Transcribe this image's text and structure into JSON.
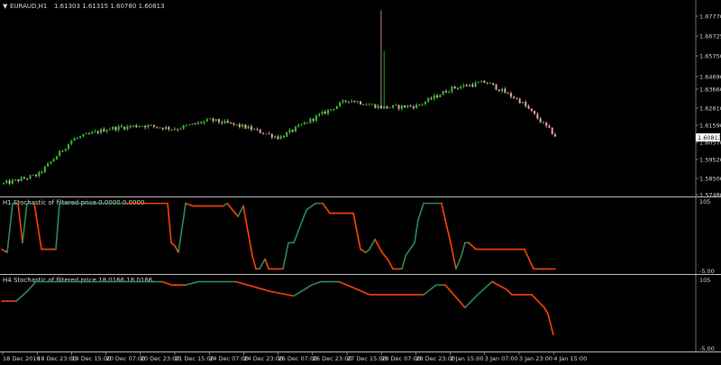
{
  "header": {
    "symbol": "EURAUD,H1",
    "ohlc": "1.61303 1.61315 1.60780 1.60813"
  },
  "price_axis": {
    "ticks": [
      "1.67770",
      "1.66725",
      "1.65750",
      "1.64690",
      "1.63660",
      "1.62610",
      "1.61590",
      "1.60570",
      "1.59520",
      "1.58500",
      "1.57480"
    ],
    "current_price": "1.60813"
  },
  "panels": {
    "h1": {
      "label": "H1 Stochastic of filtered price 0.0000 0.0000",
      "top_value": "105",
      "bottom_value": "-5.00"
    },
    "h4": {
      "label": "H4 Stochastic of filtered price 18.0166 18.0166",
      "top_value": "105",
      "bottom_value": "-5.00"
    }
  },
  "time_axis": [
    "18 Dec 2018",
    "18 Dec 23:00",
    "19 Dec 15:00",
    "20 Dec 07:00",
    "20 Dec 23:00",
    "21 Dec 15:00",
    "24 Dec 07:00",
    "24 Dec 23:00",
    "26 Dec 07:00",
    "26 Dec 23:00",
    "27 Dec 15:00",
    "28 Dec 07:00",
    "28 Dec 23:00",
    "2 Jan 15:00",
    "3 Jan 07:00",
    "3 Jan 23:00",
    "4 Jan 15:00"
  ],
  "colors": {
    "background": "#000000",
    "bull_candle": "#2ec82e",
    "bear_candle": "#e8a8a8",
    "stoch_up": "#2e8b57",
    "stoch_down": "#ff4500",
    "separator": "#bdbdbd",
    "price_tag_bg": "#ffffff"
  },
  "chart_data": [
    {
      "type": "line",
      "title": "EURAUD,H1",
      "note": "candlestick price series",
      "x": [
        "18 Dec 2018",
        "18 Dec 23:00",
        "19 Dec 15:00",
        "20 Dec 07:00",
        "20 Dec 23:00",
        "21 Dec 15:00",
        "24 Dec 07:00",
        "24 Dec 23:00",
        "26 Dec 07:00",
        "26 Dec 23:00",
        "27 Dec 15:00",
        "28 Dec 07:00",
        "28 Dec 23:00",
        "2 Jan 15:00",
        "3 Jan 07:00",
        "3 Jan 23:00",
        "4 Jan 15:00"
      ],
      "series": [
        {
          "values": [
            1.581,
            1.586,
            1.606,
            1.612,
            1.614,
            1.612,
            1.617,
            1.613,
            1.607,
            1.618,
            1.6285,
            1.624,
            1.625,
            1.635,
            1.6385,
            1.6275,
            1.6081
          ]
        }
      ],
      "ylim": [
        1.5748,
        1.6777
      ]
    },
    {
      "type": "line",
      "title": "H1 Stochastic of filtered price 0.0000 0.0000",
      "x": [
        "18 Dec 2018",
        "18 Dec 23:00",
        "19 Dec 15:00",
        "20 Dec 07:00",
        "20 Dec 23:00",
        "21 Dec 15:00",
        "24 Dec 07:00",
        "24 Dec 23:00",
        "26 Dec 07:00",
        "26 Dec 23:00",
        "27 Dec 15:00",
        "28 Dec 07:00",
        "28 Dec 23:00",
        "2 Jan 15:00",
        "3 Jan 07:00",
        "3 Jan 23:00",
        "4 Jan 15:00"
      ],
      "series": [
        {
          "values": [
            50,
            100,
            100,
            100,
            100,
            40,
            90,
            85,
            0,
            25,
            100,
            70,
            0,
            100,
            50,
            40,
            0
          ]
        }
      ],
      "ylim": [
        -5,
        105
      ]
    },
    {
      "type": "line",
      "title": "H4 Stochastic of filtered price 18.0166 18.0166",
      "x": [
        "18 Dec 2018",
        "18 Dec 23:00",
        "19 Dec 15:00",
        "20 Dec 07:00",
        "20 Dec 23:00",
        "21 Dec 15:00",
        "24 Dec 07:00",
        "24 Dec 23:00",
        "26 Dec 07:00",
        "26 Dec 23:00",
        "27 Dec 15:00",
        "28 Dec 07:00",
        "28 Dec 23:00",
        "2 Jan 15:00",
        "3 Jan 07:00",
        "3 Jan 23:00",
        "4 Jan 15:00"
      ],
      "series": [
        {
          "values": [
            70,
            100,
            100,
            100,
            100,
            95,
            100,
            100,
            85,
            100,
            100,
            80,
            80,
            90,
            70,
            100,
            18
          ]
        }
      ],
      "ylim": [
        -5,
        105
      ]
    }
  ]
}
